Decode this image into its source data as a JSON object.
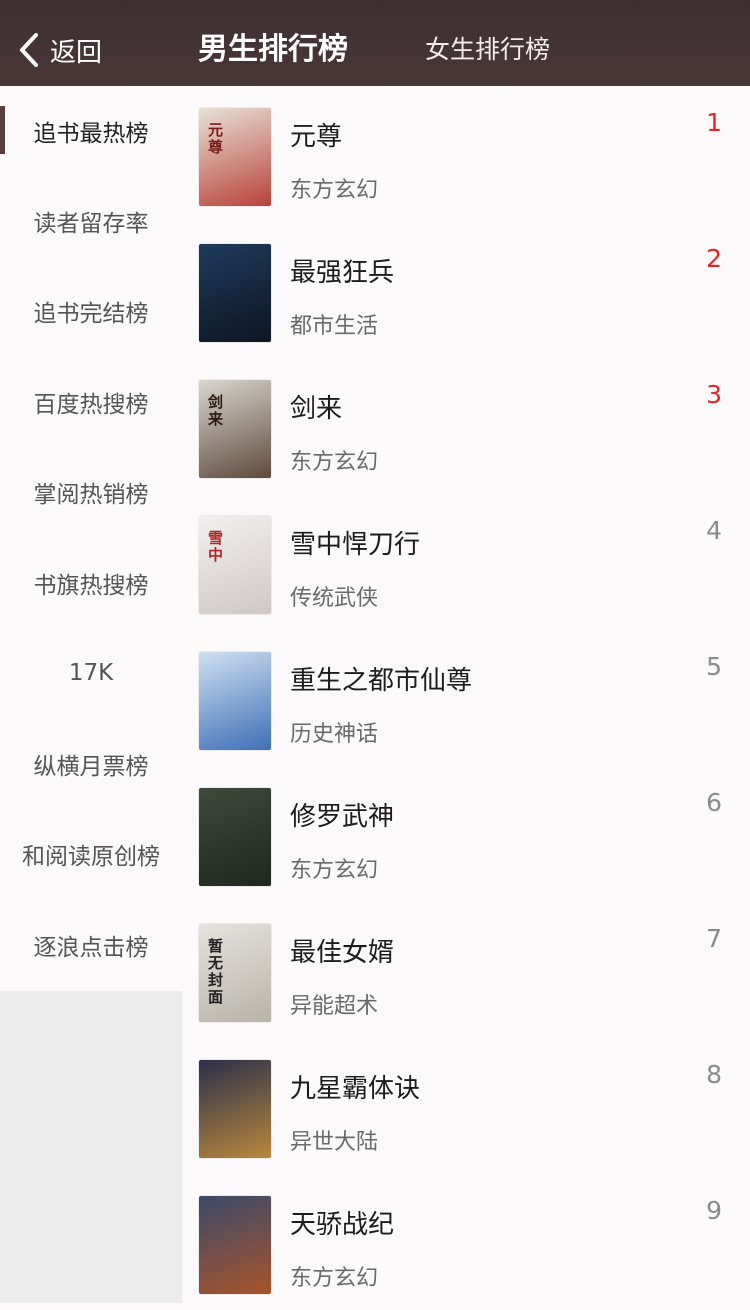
{
  "header": {
    "back_label": "返回",
    "tab_active": "男生排行榜",
    "tab_other": "女生排行榜"
  },
  "sidebar": {
    "items": [
      {
        "label": "追书最热榜"
      },
      {
        "label": "读者留存率"
      },
      {
        "label": "追书完结榜"
      },
      {
        "label": "百度热搜榜"
      },
      {
        "label": "掌阅热销榜"
      },
      {
        "label": "书旗热搜榜"
      },
      {
        "label": "17K"
      },
      {
        "label": "纵横月票榜"
      },
      {
        "label": "和阅读原创榜"
      },
      {
        "label": "逐浪点击榜"
      }
    ],
    "active_index": 0
  },
  "books": [
    {
      "rank": "1",
      "title": "元尊",
      "genre": "东方玄幻",
      "cover_colors": [
        "#e8e2d6",
        "#b8423b"
      ],
      "cover_text": "元尊",
      "cover_text_color": "#7a1f1a"
    },
    {
      "rank": "2",
      "title": "最强狂兵",
      "genre": "都市生活",
      "cover_colors": [
        "#1e3a5a",
        "#0e1624"
      ],
      "cover_text": "",
      "cover_text_color": "#ffffff"
    },
    {
      "rank": "3",
      "title": "剑来",
      "genre": "东方玄幻",
      "cover_colors": [
        "#d9d6cf",
        "#5f4a3c"
      ],
      "cover_text": "剑来",
      "cover_text_color": "#2a1a12"
    },
    {
      "rank": "4",
      "title": "雪中悍刀行",
      "genre": "传统武侠",
      "cover_colors": [
        "#f2f0ee",
        "#cfc8c6"
      ],
      "cover_text": "雪中",
      "cover_text_color": "#b0262a"
    },
    {
      "rank": "5",
      "title": "重生之都市仙尊",
      "genre": "历史神话",
      "cover_colors": [
        "#cfe0f0",
        "#3f6fb6"
      ],
      "cover_text": "",
      "cover_text_color": "#ffffff"
    },
    {
      "rank": "6",
      "title": "修罗武神",
      "genre": "东方玄幻",
      "cover_colors": [
        "#3e4a3c",
        "#1f261f"
      ],
      "cover_text": "",
      "cover_text_color": "#e9e2c8"
    },
    {
      "rank": "7",
      "title": "最佳女婿",
      "genre": "异能超术",
      "cover_colors": [
        "#e5e3df",
        "#b9b3a8"
      ],
      "cover_text": "暂无封面",
      "cover_text_color": "#222222"
    },
    {
      "rank": "8",
      "title": "九星霸体诀",
      "genre": "异世大陆",
      "cover_colors": [
        "#2b2f4a",
        "#b8883d"
      ],
      "cover_text": "",
      "cover_text_color": "#ffffff"
    },
    {
      "rank": "9",
      "title": "天骄战纪",
      "genre": "东方玄幻",
      "cover_colors": [
        "#3b4a6a",
        "#a8542c"
      ],
      "cover_text": "",
      "cover_text_color": "#f0c24a"
    }
  ],
  "colors": {
    "header_bg": "#3e2f30",
    "rank_top": "#e0252a",
    "rank_other": "#8b8b8b"
  }
}
